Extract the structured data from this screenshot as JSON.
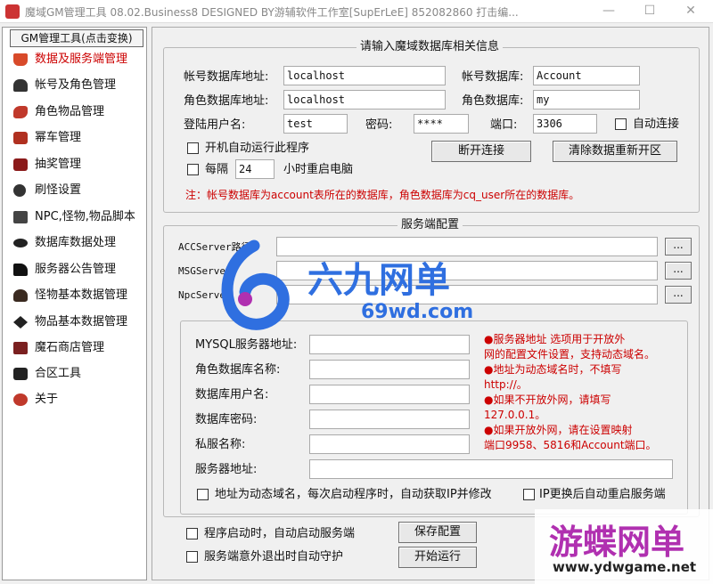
{
  "titlebar": {
    "title": "魔域GM管理工具 08.02.Business8 DESIGNED BY游辅软件工作室[SupErLeE] 852082860 打击编...",
    "minimize": "—",
    "maximize": "☐",
    "close": "✕"
  },
  "sidebar": {
    "header": "GM管理工具(点击变换)",
    "items": [
      {
        "label": "数据及服务端管理",
        "icon": "database-icon",
        "active": true
      },
      {
        "label": "帐号及角色管理",
        "icon": "user-icon"
      },
      {
        "label": "角色物品管理",
        "icon": "item-icon"
      },
      {
        "label": "幂车管理",
        "icon": "seal-icon"
      },
      {
        "label": "抽奖管理",
        "icon": "lottery-icon"
      },
      {
        "label": "刷怪设置",
        "icon": "monster-icon"
      },
      {
        "label": "NPC,怪物,物品脚本",
        "icon": "npc-icon"
      },
      {
        "label": "数据库数据处理",
        "icon": "database-process-icon"
      },
      {
        "label": "服务器公告管理",
        "icon": "announcement-icon"
      },
      {
        "label": "怪物基本数据管理",
        "icon": "monster-data-icon"
      },
      {
        "label": "物品基本数据管理",
        "icon": "item-data-icon"
      },
      {
        "label": "魔石商店管理",
        "icon": "shop-icon"
      },
      {
        "label": "合区工具",
        "icon": "merge-icon"
      },
      {
        "label": "关于",
        "icon": "about-icon"
      }
    ]
  },
  "db": {
    "group_title": "请输入魔域数据库相关信息",
    "account_db_addr_label": "帐号数据库地址:",
    "account_db_addr": "localhost",
    "account_db_label": "帐号数据库:",
    "account_db": "Account",
    "role_db_addr_label": "角色数据库地址:",
    "role_db_addr": "localhost",
    "role_db_label": "角色数据库:",
    "role_db": "my",
    "user_label": "登陆用户名:",
    "user": "test",
    "password_label": "密码:",
    "password": "****",
    "port_label": "端口:",
    "port": "3306",
    "auto_connect_label": "自动连接",
    "autorun_label": "开机自动运行此程序",
    "every_label": "每隔",
    "hours": "24",
    "reboot_label": "小时重启电脑",
    "disconnect_button": "断开连接",
    "clear_button": "清除数据重新开区",
    "note": "注：帐号数据库为account表所在的数据库，角色数据库为cq_user所在的数据库。"
  },
  "server": {
    "group_title": "服务端配置",
    "acc_label": "ACCServer路径:",
    "msg_label": "MSGServer",
    "npc_label": "NpcServe",
    "browse": "...",
    "mysql_label": "MYSQL服务器地址:",
    "role_db_name_label": "角色数据库名称:",
    "db_user_label": "数据库用户名:",
    "db_password_label": "数据库密码:",
    "private_name_label": "私服名称:",
    "server_addr_label": "服务器地址:",
    "notes": [
      "●服务器地址 选项用于开放外",
      "网的配置文件设置，支持动态域名。",
      "●地址为动态域名时，不填写",
      "http://。",
      "●如果不开放外网，请填写",
      "127.0.0.1。",
      "●如果开放外网，请在设置映射",
      "端口9958、5816和Account端口。"
    ],
    "dynamic_domain_label": "地址为动态域名，每次启动程序时，自动获取IP并修改",
    "ip_restart_label": "IP更换后自动重启服务端"
  },
  "bottom": {
    "auto_start_label": "程序启动时，自动启动服务端",
    "guard_label": "服务端意外退出时自动守护",
    "save_button": "保存配置",
    "start_button": "开始运行"
  },
  "watermark": {
    "brand1": "六九网单",
    "url1": "69wd.com",
    "brand2": "游蝶网单",
    "url2": "www.ydwgame.net"
  },
  "colors": {
    "note_red": "#cc0000",
    "watermark_blue": "#2f6fe0",
    "watermark_purple": "#b030b0"
  }
}
